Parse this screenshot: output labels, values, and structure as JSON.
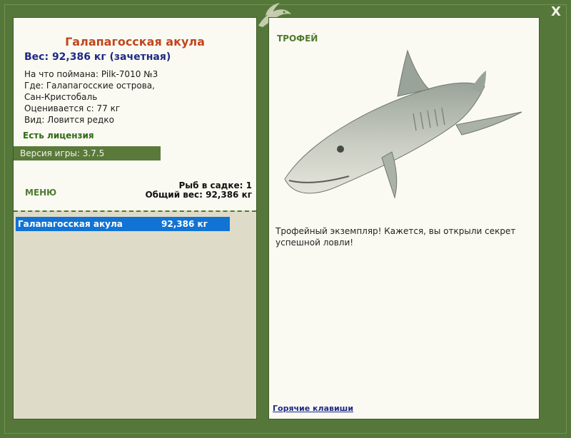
{
  "window": {
    "close_label": "X"
  },
  "fish": {
    "name": "Галапагосская акула",
    "weight": "Вес: 92,386 кг (зачетная)",
    "caught_with": "На что поймана: Pilk-7010 №3",
    "location_line1": "Где: Галапагосские острова,",
    "location_line2": "Сан-Кристобаль",
    "valued": "Оценивается с: 77 кг",
    "rarity": "Вид: Ловится редко"
  },
  "license": "Есть лицензия",
  "version": "Версия игры: 3.7.5",
  "menu_label": "МЕНЮ",
  "keepnet": {
    "count": "Рыб в садке: 1",
    "total_weight": "Общий вес: 92,386 кг",
    "items": [
      {
        "name": "Галапагосская акула",
        "weight": "92,386 кг"
      }
    ]
  },
  "trophy": {
    "label": "ТРОФЕЙ",
    "description": "Трофейный экземпляр! Кажется, вы открыли секрет успешной ловли!"
  },
  "hotkeys_label": "Горячие клавиши"
}
